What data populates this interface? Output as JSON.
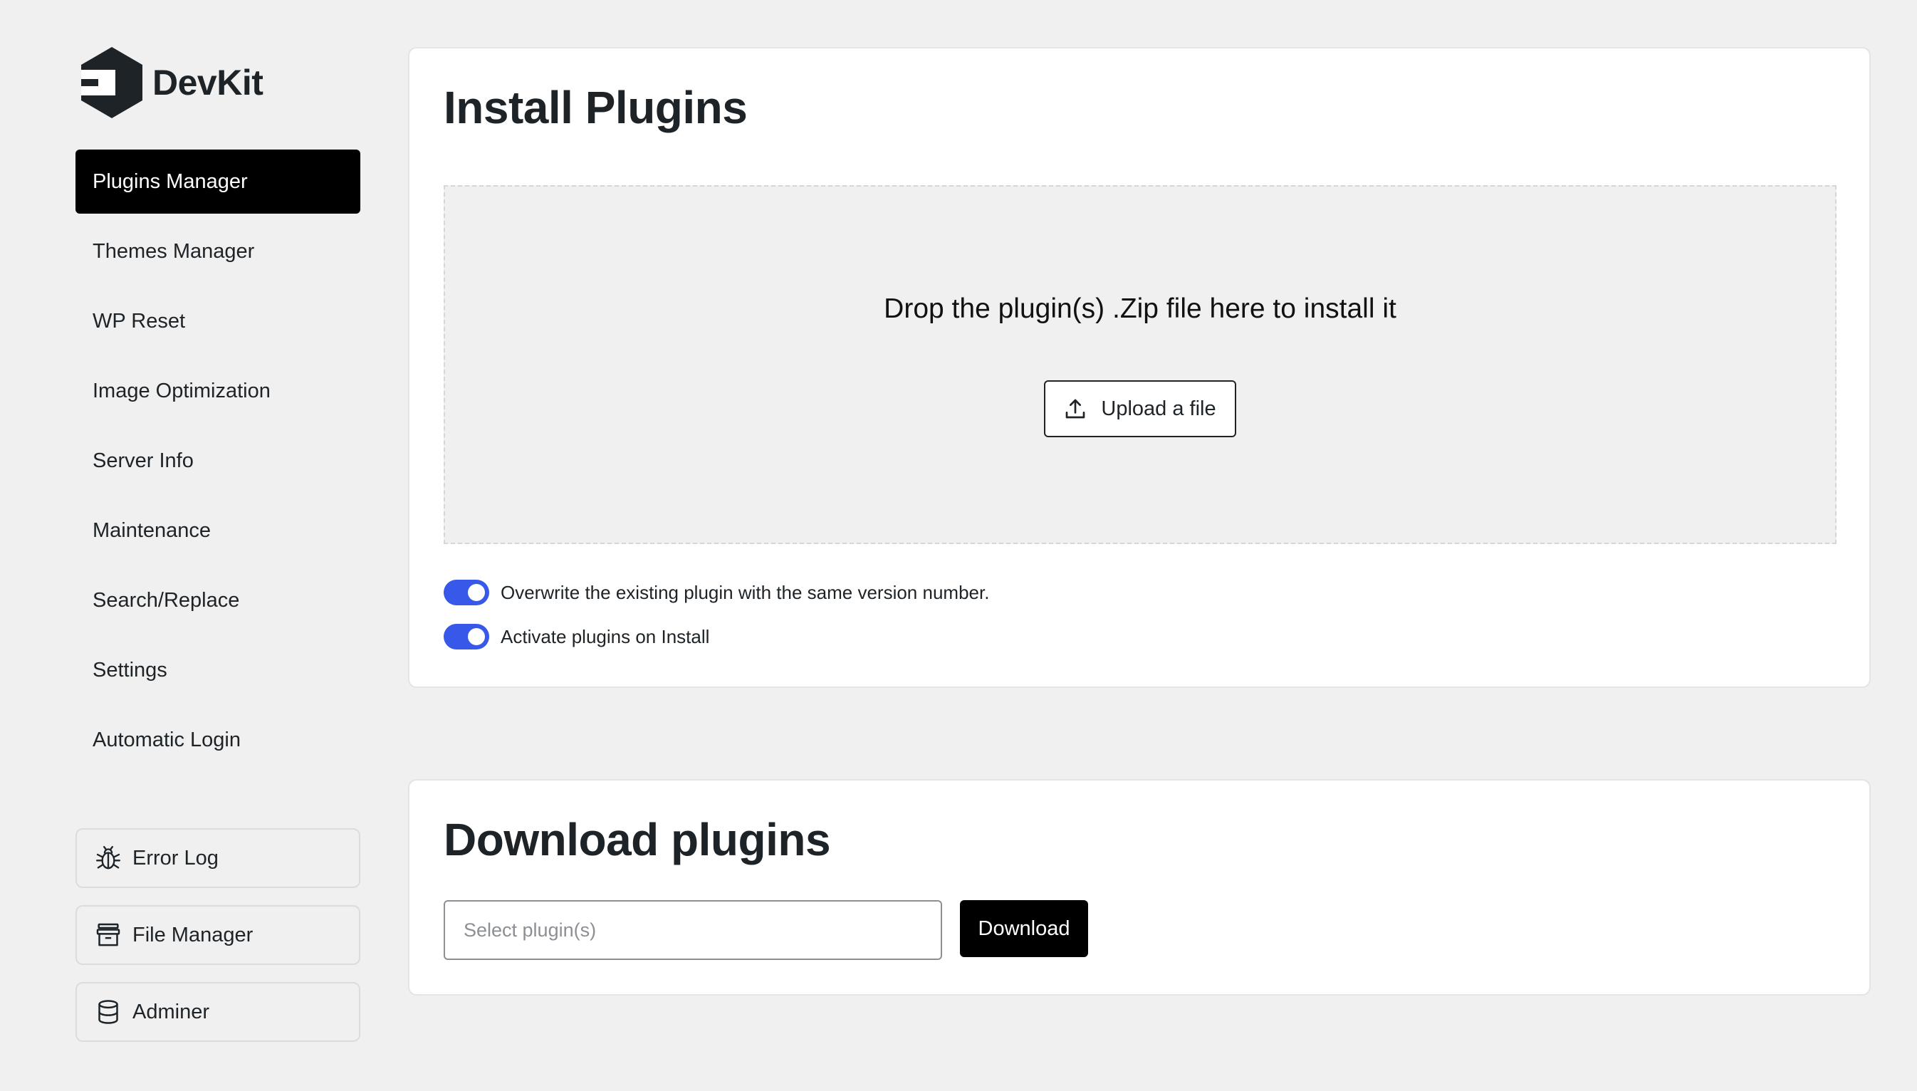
{
  "brand": {
    "name": "DevKit"
  },
  "sidebar": {
    "items": [
      {
        "label": "Plugins Manager",
        "active": true
      },
      {
        "label": "Themes Manager"
      },
      {
        "label": "WP Reset"
      },
      {
        "label": "Image Optimization"
      },
      {
        "label": "Server Info"
      },
      {
        "label": "Maintenance"
      },
      {
        "label": "Search/Replace"
      },
      {
        "label": "Settings"
      },
      {
        "label": "Automatic Login"
      }
    ],
    "tools": [
      {
        "label": "Error Log",
        "icon": "bug-icon"
      },
      {
        "label": "File Manager",
        "icon": "archive-icon"
      },
      {
        "label": "Adminer",
        "icon": "database-icon"
      }
    ]
  },
  "install": {
    "title": "Install Plugins",
    "drop_text": "Drop the plugin(s) .Zip file here to install it",
    "upload_label": "Upload a file",
    "options": [
      {
        "label": "Overwrite the existing plugin with the same version number.",
        "enabled": true
      },
      {
        "label": "Activate plugins on Install",
        "enabled": true
      }
    ]
  },
  "download": {
    "title": "Download plugins",
    "select_placeholder": "Select plugin(s)",
    "button_label": "Download"
  },
  "colors": {
    "accent": "#3858e9",
    "active_nav": "#000000"
  }
}
